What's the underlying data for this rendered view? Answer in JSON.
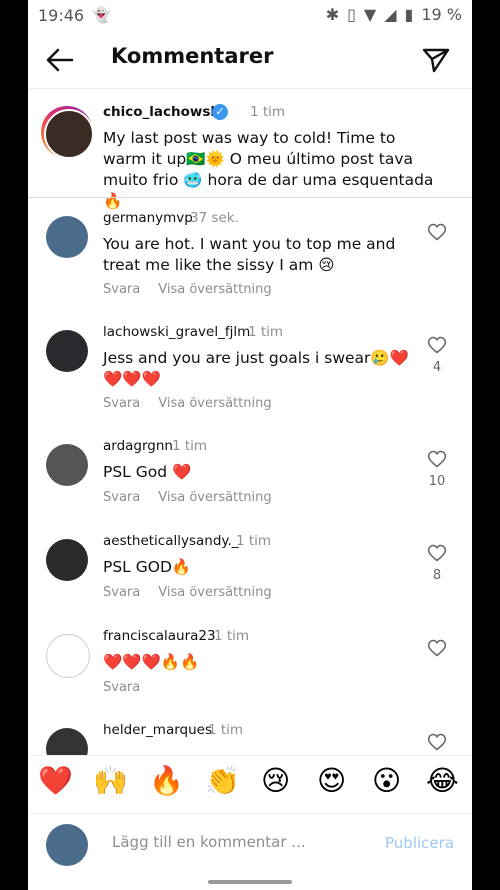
{
  "status": {
    "time": "19:46",
    "battery": "19 %"
  },
  "header": {
    "title": "Kommentarer"
  },
  "caption": {
    "username": "chico_lachowski",
    "time": "1 tim",
    "text": "My last post was way to cold! Time to warm it up🇧🇷🌞 O meu último post tava muito frio 🥶 hora de dar uma esquentada 🔥"
  },
  "comments": [
    {
      "username": "germanymvp",
      "time": "37 sek.",
      "text": "You are hot. I want you to top me and treat me like the sissy I am 😢",
      "reply": "Svara",
      "translate": "Visa översättning",
      "likes": ""
    },
    {
      "username": "lachowski_gravel_fjlm",
      "time": "1 tim",
      "text": "Jess and you are just goals i swear🥲❤️❤️❤️❤️",
      "reply": "Svara",
      "translate": "Visa översättning",
      "likes": "4"
    },
    {
      "username": "ardagrgnn",
      "time": "1 tim",
      "text": "PSL God ❤️",
      "reply": "Svara",
      "translate": "Visa översättning",
      "likes": "10"
    },
    {
      "username": "aestheticallysandy._",
      "time": "1 tim",
      "text": "PSL GOD🔥",
      "reply": "Svara",
      "translate": "Visa översättning",
      "likes": "8"
    },
    {
      "username": "franciscalaura23",
      "time": "1 tim",
      "text": "❤️❤️❤️🔥🔥",
      "reply": "Svara",
      "translate": "",
      "likes": ""
    },
    {
      "username": "helder_marques",
      "time": "1 tim",
      "text": "",
      "reply": "",
      "translate": "",
      "likes": ""
    }
  ],
  "reactions": [
    "❤️",
    "🙌",
    "🔥",
    "👏",
    "😢",
    "😍",
    "😮",
    "😂"
  ],
  "composer": {
    "placeholder": "Lägg till en kommentar ...",
    "publish": "Publicera"
  },
  "icons": {
    "back": "arrow-left-icon",
    "send": "paper-plane-icon",
    "heart": "heart-outline-icon"
  },
  "colors": {
    "accent": "#3897f0",
    "publish_disabled": "#9ec9f0",
    "muted": "#8e8e8e"
  }
}
